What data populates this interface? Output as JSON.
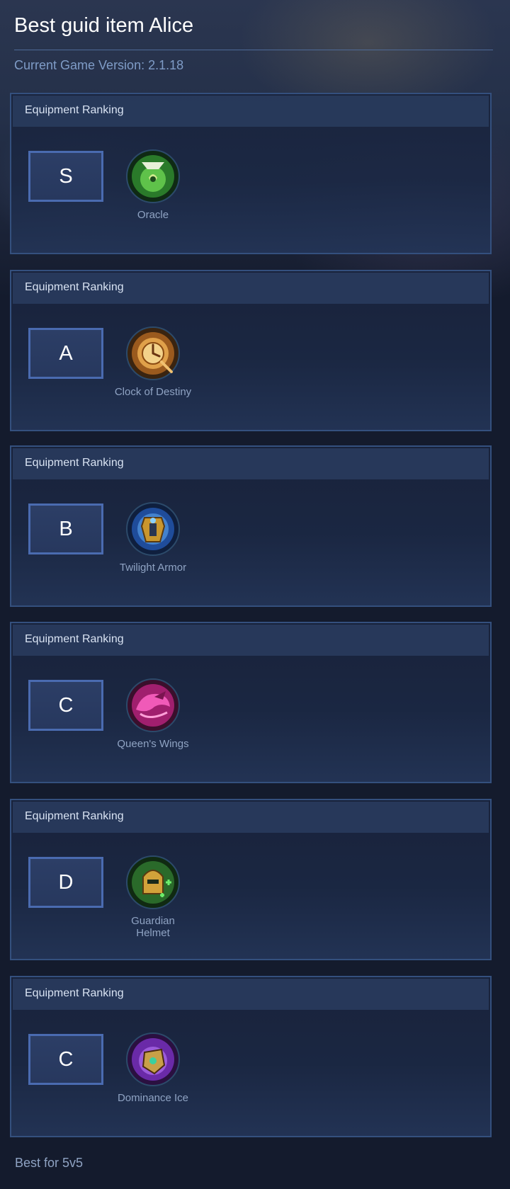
{
  "page": {
    "title": "Best guid item Alice",
    "version": "Current Game Version: 2.1.18",
    "footer": "Best for 5v5"
  },
  "rankings": [
    {
      "header": "Equipment Ranking",
      "tier": "S",
      "item": "Oracle",
      "icon": "oracle-icon",
      "color": "#3fae3a"
    },
    {
      "header": "Equipment Ranking",
      "tier": "A",
      "item": "Clock of Destiny",
      "icon": "clock-of-destiny-icon",
      "color": "#d48a2a"
    },
    {
      "header": "Equipment Ranking",
      "tier": "B",
      "item": "Twilight Armor",
      "icon": "twilight-armor-icon",
      "color": "#3a7fd8"
    },
    {
      "header": "Equipment Ranking",
      "tier": "C",
      "item": "Queen's Wings",
      "icon": "queens-wings-icon",
      "color": "#d8349a"
    },
    {
      "header": "Equipment Ranking",
      "tier": "D",
      "item": "Guardian Helmet",
      "icon": "guardian-helmet-icon",
      "color": "#3f9a3a"
    },
    {
      "header": "Equipment Ranking",
      "tier": "C",
      "item": "Dominance Ice",
      "icon": "dominance-ice-icon",
      "color": "#8c4ad0"
    }
  ]
}
